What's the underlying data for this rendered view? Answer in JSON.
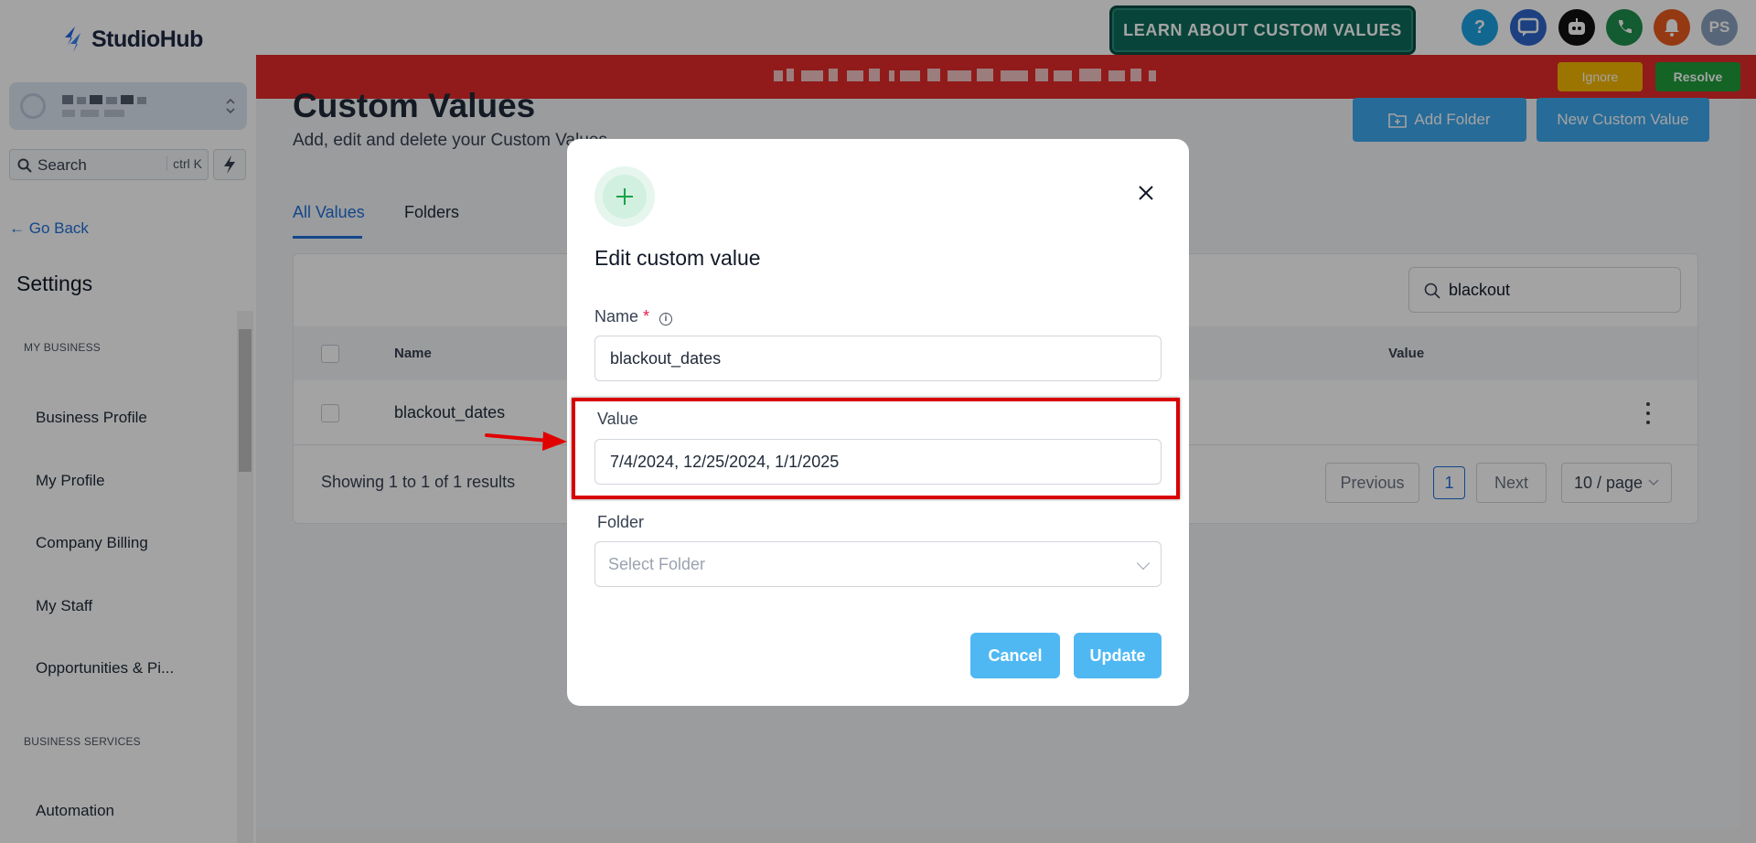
{
  "header": {
    "brand": "StudioHub",
    "learn_button": "LEARN ABOUT CUSTOM VALUES",
    "avatar_initials": "PS",
    "help_glyph": "?",
    "icons": [
      "help-icon",
      "chat-icon",
      "ai-bot-icon",
      "phone-icon",
      "bell-icon",
      "avatar"
    ]
  },
  "sidebar": {
    "search_placeholder": "Search",
    "search_shortcut": "ctrl K",
    "go_back": "Go Back",
    "settings_title": "Settings",
    "sections": [
      {
        "label": "MY BUSINESS",
        "items": [
          "Business Profile",
          "My Profile",
          "Company Billing",
          "My Staff",
          "Opportunities & Pi..."
        ]
      },
      {
        "label": "BUSINESS SERVICES",
        "items": [
          "Automation"
        ]
      }
    ]
  },
  "banner": {
    "ignore": "Ignore",
    "resolve": "Resolve"
  },
  "page": {
    "title": "Custom Values",
    "subtitle": "Add, edit and delete your Custom Values",
    "add_folder": "Add Folder",
    "new_custom_value": "New Custom Value",
    "tabs": [
      "All Values",
      "Folders"
    ],
    "active_tab": "All Values",
    "search_value": "blackout",
    "table": {
      "columns": [
        "Name",
        "Value"
      ],
      "rows": [
        {
          "name": "blackout_dates",
          "value": ""
        }
      ]
    },
    "showing": "Showing 1 to 1 of 1 results",
    "pagination": {
      "previous": "Previous",
      "current": "1",
      "next": "Next",
      "page_size": "10 / page"
    }
  },
  "modal": {
    "title": "Edit custom value",
    "name_label": "Name",
    "required_mark": "*",
    "name_value": "blackout_dates",
    "value_label": "Value",
    "value_value": "7/4/2024, 12/25/2024, 1/1/2025",
    "folder_label": "Folder",
    "folder_placeholder": "Select Folder",
    "cancel": "Cancel",
    "update": "Update"
  },
  "colors": {
    "accent": "#1e6fd9",
    "primary_button": "#4fb8f3",
    "banner": "#e32b2b",
    "annotation": "#d80000"
  }
}
